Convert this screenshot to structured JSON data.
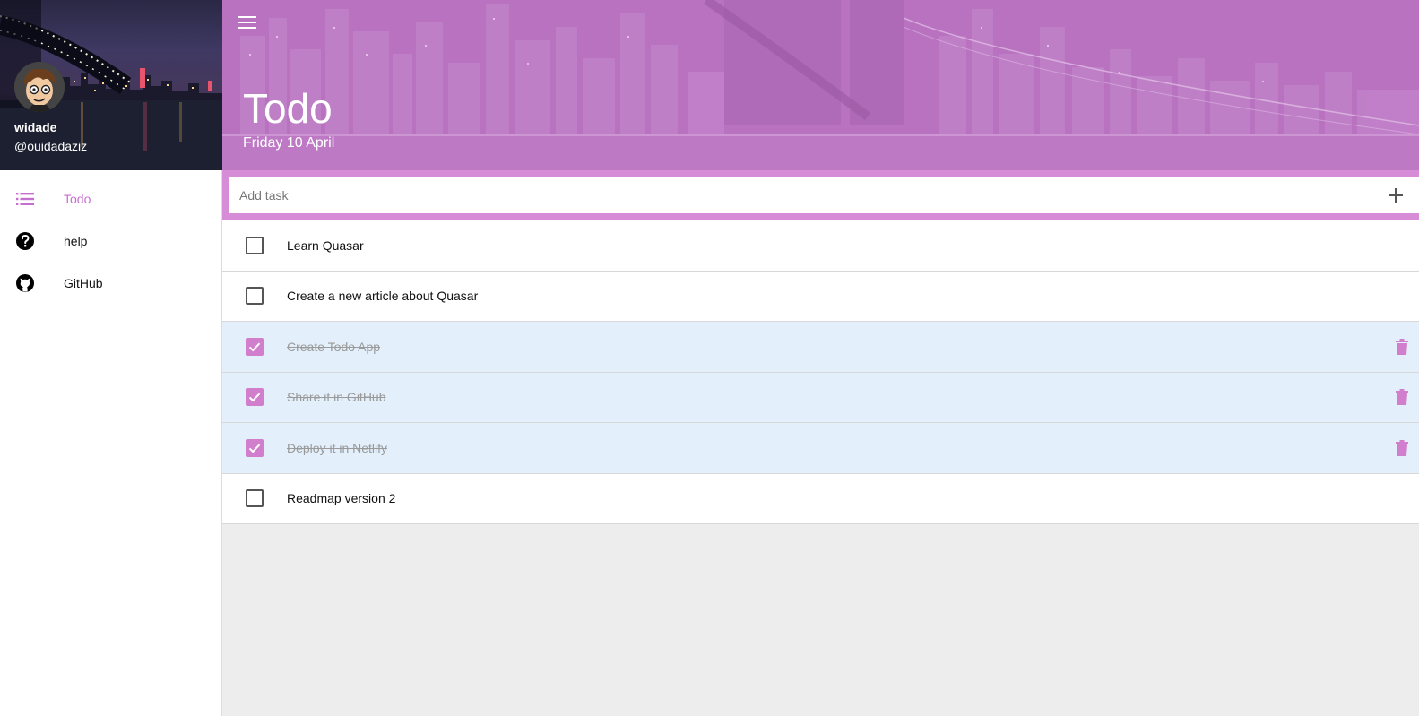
{
  "drawer": {
    "user": {
      "name": "widade",
      "handle": "@ouidadaziz"
    },
    "items": [
      {
        "label": "Todo",
        "icon": "list-icon",
        "active": true
      },
      {
        "label": "help",
        "icon": "help-icon",
        "active": false
      },
      {
        "label": "GitHub",
        "icon": "github-icon",
        "active": false
      }
    ]
  },
  "header": {
    "title": "Todo",
    "date": "Friday 10 April",
    "menu_icon": "menu-icon"
  },
  "add_task": {
    "placeholder": "Add task",
    "add_icon": "plus-icon"
  },
  "tasks": [
    {
      "label": "Learn Quasar",
      "done": false
    },
    {
      "label": "Create a new article about Quasar",
      "done": false
    },
    {
      "label": "Create Todo App",
      "done": true
    },
    {
      "label": "Share it in GitHub",
      "done": true
    },
    {
      "label": "Deploy it in Netlify",
      "done": true
    },
    {
      "label": "Readmap version 2",
      "done": false
    }
  ],
  "colors": {
    "accent": "#d17ecd",
    "header_tint": "#b872c0",
    "done_row": "#e3f0fb",
    "add_bar": "#d68cd6"
  }
}
